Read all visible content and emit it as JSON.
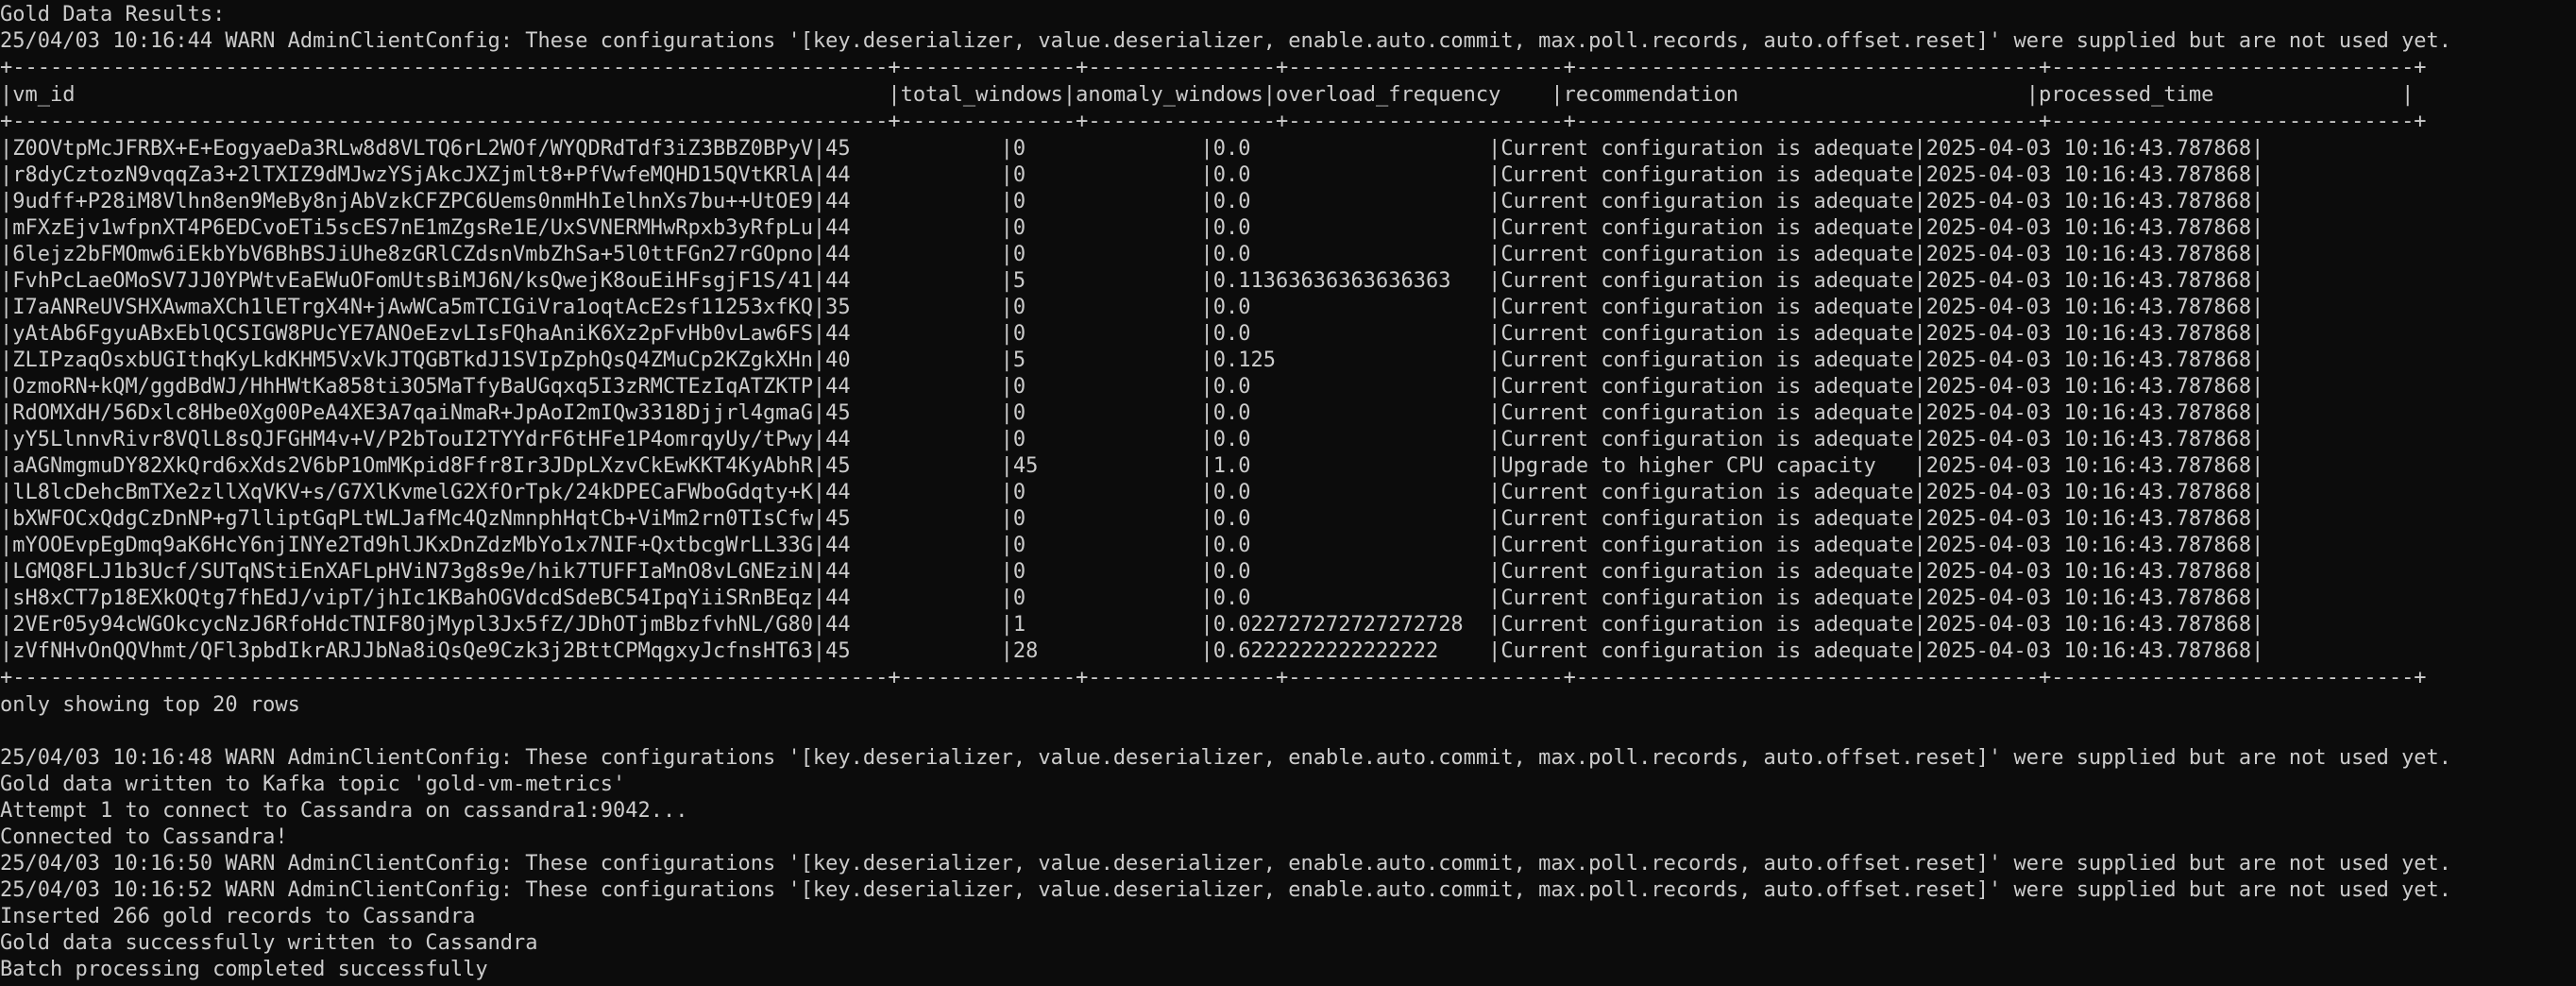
{
  "terminal": {
    "lines": [
      "Gold Data Results:",
      "25/04/03 10:16:44 WARN AdminClientConfig: These configurations '[key.deserializer, value.deserializer, enable.auto.commit, max.poll.records, auto.offset.reset]' were supplied but are not used yet.",
      "+----------------------------------------------------------------------+--------------+---------------+----------------------+-------------------------------------+-----------------------------+",
      "|vm_id                                                                 |total_windows|anomaly_windows|overload_frequency    |recommendation                       |processed_time               |",
      "+----------------------------------------------------------------------+--------------+---------------+----------------------+-------------------------------------+-----------------------------+",
      "|Z0OVtpMcJFRBX+E+EogyaeDa3RLw8d8VLTQ6rL2WOf/WYQDRdTdf3iZ3BBZ0BPyV|45            |0              |0.0                   |Current configuration is adequate|2025-04-03 10:16:43.787868|",
      "|r8dyCztozN9vqqZa3+2lTXIZ9dMJwzYSjAkcJXZjmlt8+PfVwfeMQHD15QVtKRlA|44            |0              |0.0                   |Current configuration is adequate|2025-04-03 10:16:43.787868|",
      "|9udff+P28iM8Vlhn8en9MeBy8njAbVzkCFZPC6Uems0nmHhIelhnXs7bu++UtOE9|44            |0              |0.0                   |Current configuration is adequate|2025-04-03 10:16:43.787868|",
      "|mFXzEjv1wfpnXT4P6EDCvoETi5scES7nE1mZgsRe1E/UxSVNERMHwRpxb3yRfpLu|44            |0              |0.0                   |Current configuration is adequate|2025-04-03 10:16:43.787868|",
      "|6lejz2bFMOmw6iEkbYbV6BhBSJiUhe8zGRlCZdsnVmbZhSa+5l0ttFGn27rGOpno|44            |0              |0.0                   |Current configuration is adequate|2025-04-03 10:16:43.787868|",
      "|FvhPcLaeOMoSV7JJ0YPWtvEaEWuOFomUtsBiMJ6N/ksQwejK8ouEiHFsgjF1S/41|44            |5              |0.11363636363636363   |Current configuration is adequate|2025-04-03 10:16:43.787868|",
      "|I7aANReUVSHXAwmaXCh1lETrgX4N+jAwWCa5mTCIGiVra1oqtAcE2sf11253xfKQ|35            |0              |0.0                   |Current configuration is adequate|2025-04-03 10:16:43.787868|",
      "|yAtAb6FgyuABxEblQCSIGW8PUcYE7ANOeEzvLIsFQhaAniK6Xz2pFvHb0vLaw6FS|44            |0              |0.0                   |Current configuration is adequate|2025-04-03 10:16:43.787868|",
      "|ZLIPzaqOsxbUGIthqKyLkdKHM5VxVkJTQGBTkdJ1SVIpZphQsQ4ZMuCp2KZgkXHn|40            |5              |0.125                 |Current configuration is adequate|2025-04-03 10:16:43.787868|",
      "|OzmoRN+kQM/ggdBdWJ/HhHWtKa858ti3O5MaTfyBaUGqxq5I3zRMCTEzIqATZKTP|44            |0              |0.0                   |Current configuration is adequate|2025-04-03 10:16:43.787868|",
      "|RdOMXdH/56Dxlc8Hbe0Xg00PeA4XE3A7qaiNmaR+JpAoI2mIQw3318Djjrl4gmaG|45            |0              |0.0                   |Current configuration is adequate|2025-04-03 10:16:43.787868|",
      "|yY5LlnnvRivr8VQlL8sQJFGHM4v+V/P2bTouI2TYYdrF6tHFe1P4omrqyUy/tPwy|44            |0              |0.0                   |Current configuration is adequate|2025-04-03 10:16:43.787868|",
      "|aAGNmgmuDY82XkQrd6xXds2V6bP1OmMKpid8Ffr8Ir3JDpLXzvCkEwKKT4KyAbhR|45            |45             |1.0                   |Upgrade to higher CPU capacity   |2025-04-03 10:16:43.787868|",
      "|lL8lcDehcBmTXe2zllXqVKV+s/G7XlKvmelG2XfOrTpk/24kDPECaFWboGdqty+K|44            |0              |0.0                   |Current configuration is adequate|2025-04-03 10:16:43.787868|",
      "|bXWFOCxQdgCzDnNP+g7lliptGqPLtWLJafMc4QzNmnphHqtCb+ViMm2rn0TIsCfw|45            |0              |0.0                   |Current configuration is adequate|2025-04-03 10:16:43.787868|",
      "|mYOOEvpEgDmq9aK6HcY6njINYe2Td9hlJKxDnZdzMbYo1x7NIF+QxtbcgWrLL33G|44            |0              |0.0                   |Current configuration is adequate|2025-04-03 10:16:43.787868|",
      "|LGMQ8FLJ1b3Ucf/SUTqNStiEnXAFLpHViN73g8s9e/hik7TUFFIaMnO8vLGNEziN|44            |0              |0.0                   |Current configuration is adequate|2025-04-03 10:16:43.787868|",
      "|sH8xCT7p18EXkOQtg7fhEdJ/vipT/jhIc1KBahOGVdcdSdeBC54IpqYiiSRnBEqz|44            |0              |0.0                   |Current configuration is adequate|2025-04-03 10:16:43.787868|",
      "|2VEr05y94cWGOkcycNzJ6RfoHdcTNIF8OjMypl3Jx5fZ/JDhOTjmBbzfvhNL/G80|44            |1              |0.022727272727272728  |Current configuration is adequate|2025-04-03 10:16:43.787868|",
      "|zVfNHvOnQQVhmt/QFl3pbdIkrARJJbNa8iQsQe9Czk3j2BttCPMqgxyJcfnsHT63|45            |28             |0.6222222222222222    |Current configuration is adequate|2025-04-03 10:16:43.787868|",
      "+----------------------------------------------------------------------+--------------+---------------+----------------------+-------------------------------------+-----------------------------+",
      "only showing top 20 rows",
      "",
      "25/04/03 10:16:48 WARN AdminClientConfig: These configurations '[key.deserializer, value.deserializer, enable.auto.commit, max.poll.records, auto.offset.reset]' were supplied but are not used yet.",
      "Gold data written to Kafka topic 'gold-vm-metrics'",
      "Attempt 1 to connect to Cassandra on cassandra1:9042...",
      "Connected to Cassandra!",
      "25/04/03 10:16:50 WARN AdminClientConfig: These configurations '[key.deserializer, value.deserializer, enable.auto.commit, max.poll.records, auto.offset.reset]' were supplied but are not used yet.",
      "25/04/03 10:16:52 WARN AdminClientConfig: These configurations '[key.deserializer, value.deserializer, enable.auto.commit, max.poll.records, auto.offset.reset]' were supplied but are not used yet.",
      "Inserted 266 gold records to Cassandra",
      "Gold data successfully written to Cassandra",
      "Batch processing completed successfully"
    ]
  }
}
